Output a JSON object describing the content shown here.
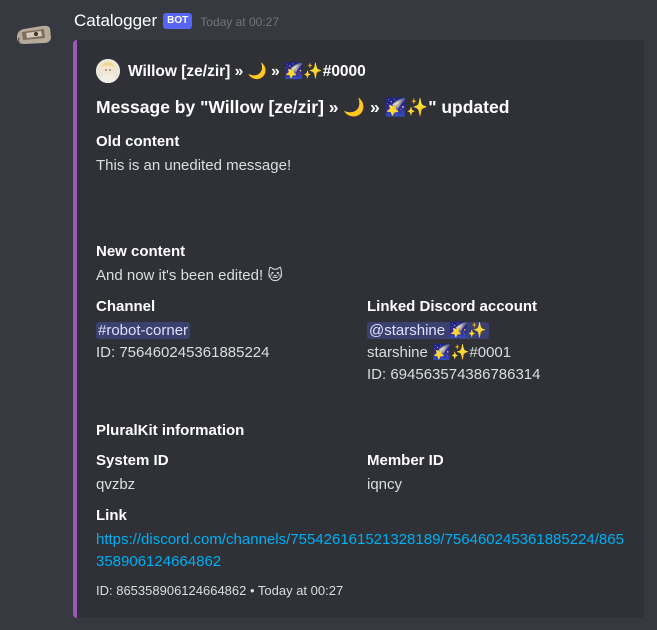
{
  "message": {
    "username": "Catalogger",
    "bot_tag": "BOT",
    "timestamp": "Today at 00:27"
  },
  "embed": {
    "accent_color": "#9b59b6",
    "author": {
      "name": "Willow [ze/zir] » 🌙 » 🌠✨#0000"
    },
    "title": "Message by \"Willow [ze/zir] » 🌙 » 🌠✨\" updated",
    "old_content": {
      "label": "Old content",
      "value": "This is an unedited message!"
    },
    "new_content": {
      "label": "New content",
      "value": "And now it's been edited! 🐱"
    },
    "channel": {
      "label": "Channel",
      "mention": "#robot-corner",
      "id_line": "ID: 756460245361885224"
    },
    "linked_account": {
      "label": "Linked Discord account",
      "mention": "@starshine 🌠✨",
      "tag": "starshine 🌠✨#0001",
      "id_line": "ID: 694563574386786314"
    },
    "pluralkit_header": "PluralKit information",
    "system_id": {
      "label": "System ID",
      "value": "qvzbz"
    },
    "member_id": {
      "label": "Member ID",
      "value": "iqncy"
    },
    "link": {
      "label": "Link",
      "url": "https://discord.com/channels/755426161521328189/756460245361885224/865358906124664862"
    },
    "footer": "ID: 865358906124664862 • Today at 00:27"
  }
}
